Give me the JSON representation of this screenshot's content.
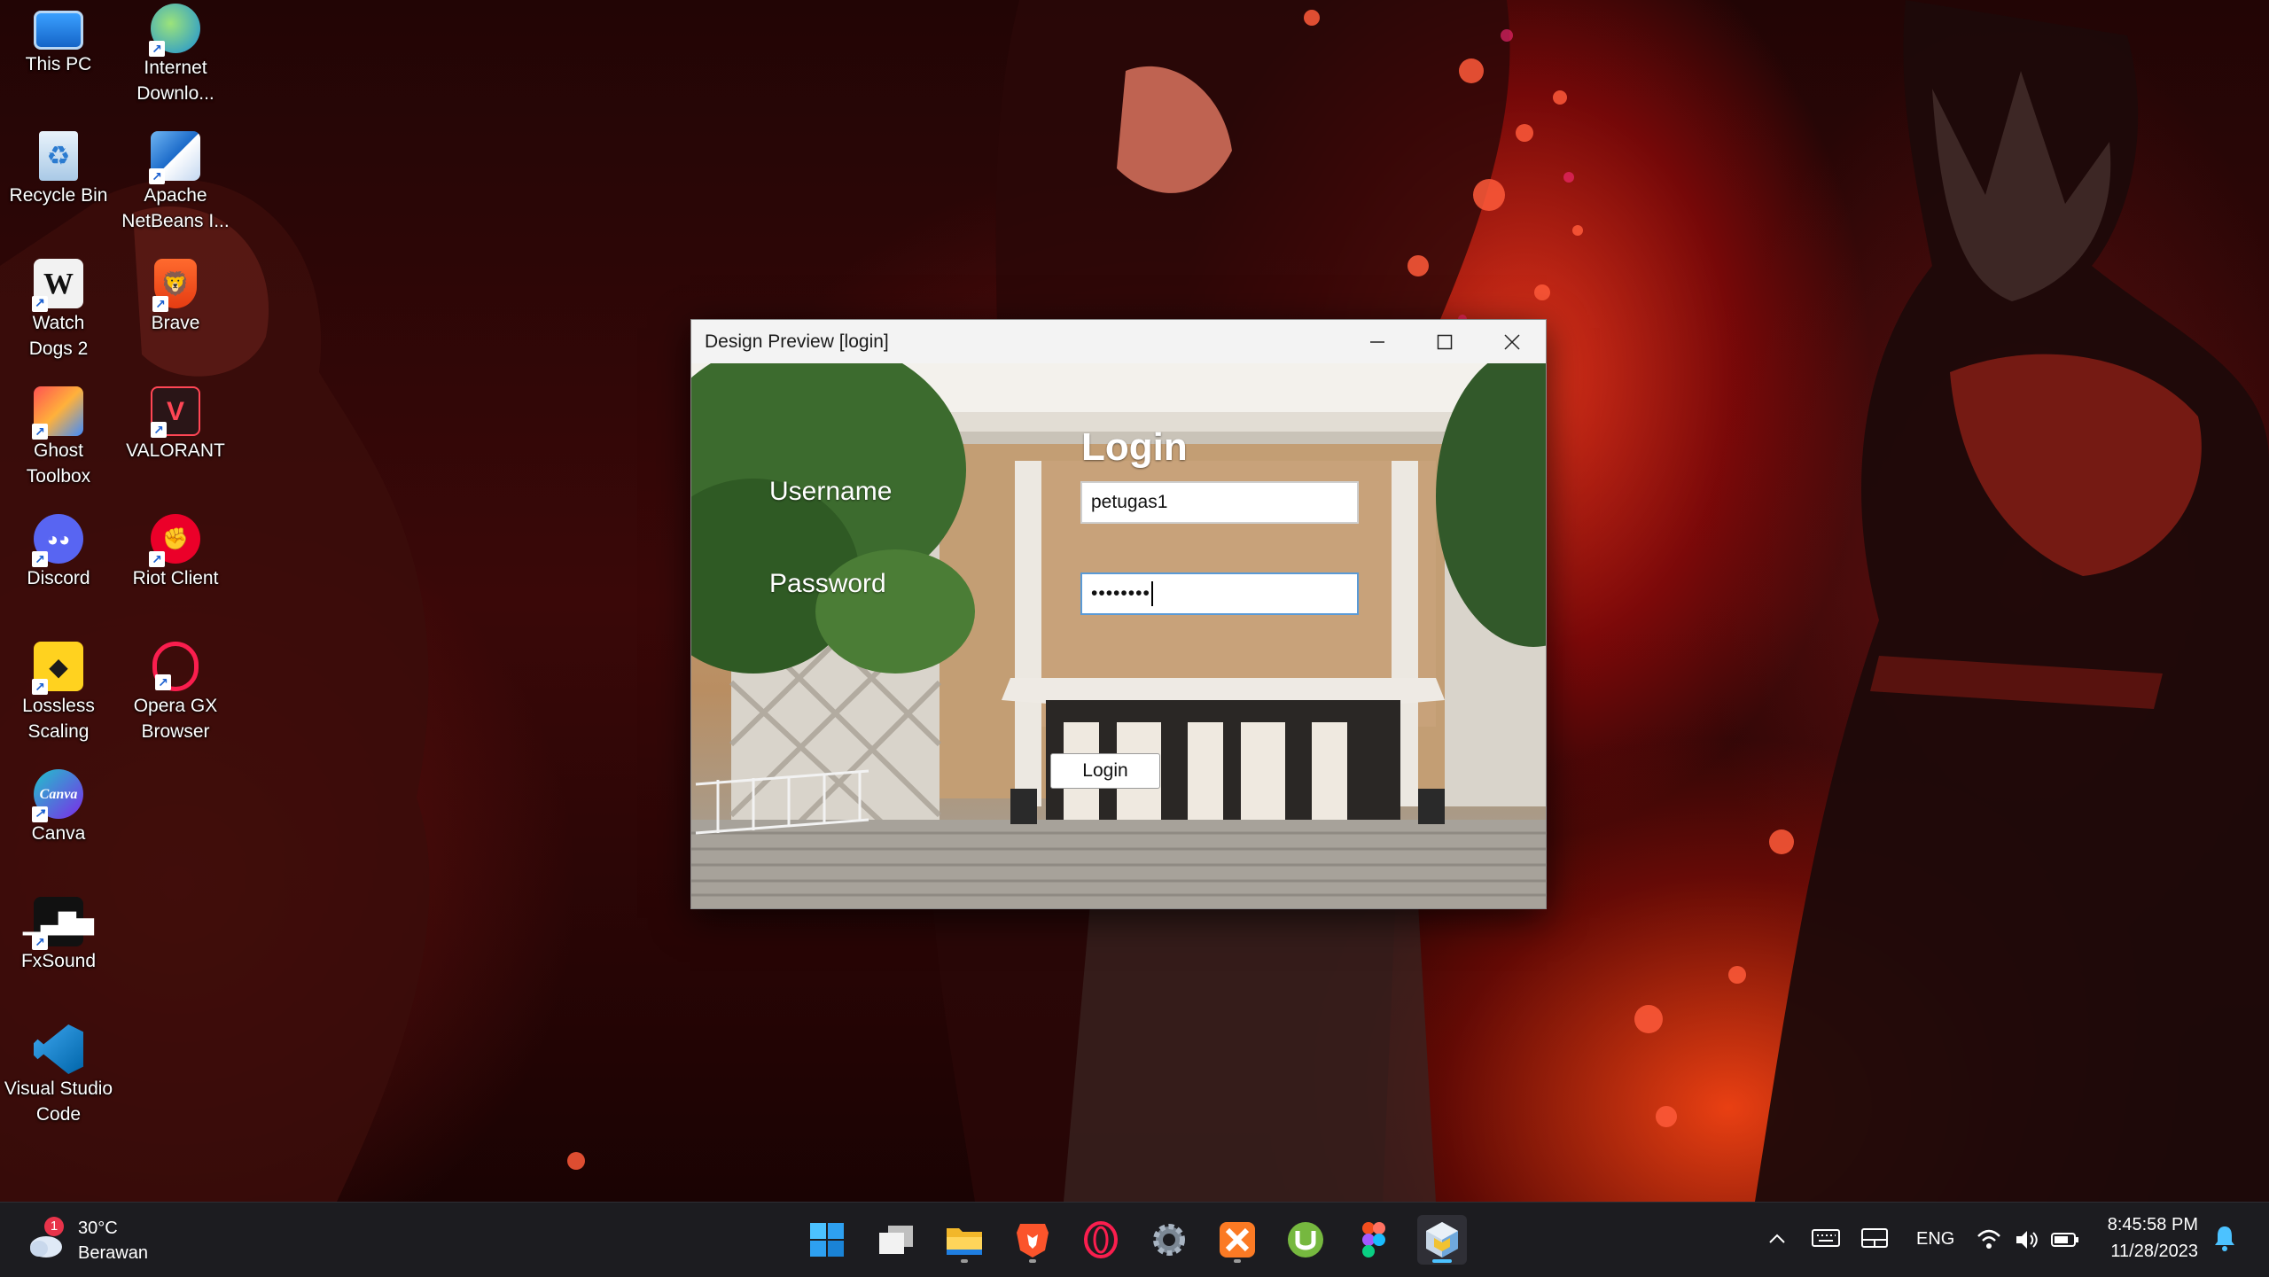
{
  "desktop": {
    "icons": [
      {
        "label": "This PC",
        "icon": "monitor-icon"
      },
      {
        "label": "Internet Downlo...",
        "icon": "idm-icon"
      },
      {
        "label": "Recycle Bin",
        "icon": "recycle-bin-icon"
      },
      {
        "label": "Apache NetBeans I...",
        "icon": "netbeans-icon"
      },
      {
        "label": "Watch Dogs 2",
        "icon": "watch-dogs-icon"
      },
      {
        "label": "Brave",
        "icon": "brave-icon"
      },
      {
        "label": "Ghost Toolbox",
        "icon": "ghost-toolbox-icon"
      },
      {
        "label": "VALORANT",
        "icon": "valorant-icon"
      },
      {
        "label": "Discord",
        "icon": "discord-icon"
      },
      {
        "label": "Riot Client",
        "icon": "riot-client-icon"
      },
      {
        "label": "Lossless Scaling",
        "icon": "lossless-scaling-icon"
      },
      {
        "label": "Opera GX Browser",
        "icon": "opera-gx-icon"
      },
      {
        "label": "Canva",
        "icon": "canva-icon"
      },
      {
        "label": "FxSound",
        "icon": "fxsound-icon"
      },
      {
        "label": "Visual Studio Code",
        "icon": "vscode-icon"
      }
    ]
  },
  "window": {
    "title": "Design Preview [login]",
    "heading": "Login",
    "username_label": "Username",
    "password_label": "Password",
    "username_value": "petugas1",
    "password_value": "••••••••",
    "login_button": "Login"
  },
  "taskbar": {
    "weather": {
      "temp": "30°C",
      "condition": "Berawan",
      "badge": "1"
    },
    "apps": [
      "start-icon",
      "task-view-icon",
      "file-explorer-icon",
      "brave-icon",
      "opera-gx-icon",
      "settings-icon",
      "xampp-icon",
      "utorrent-icon",
      "figma-icon",
      "java-design-preview-icon"
    ],
    "language": "ENG",
    "time": "8:45:58 PM",
    "date": "11/28/2023"
  },
  "colors": {
    "accent": "#4cc2ff",
    "taskbar": "#1c1c20",
    "wallpaper_red": "#e02a18"
  }
}
